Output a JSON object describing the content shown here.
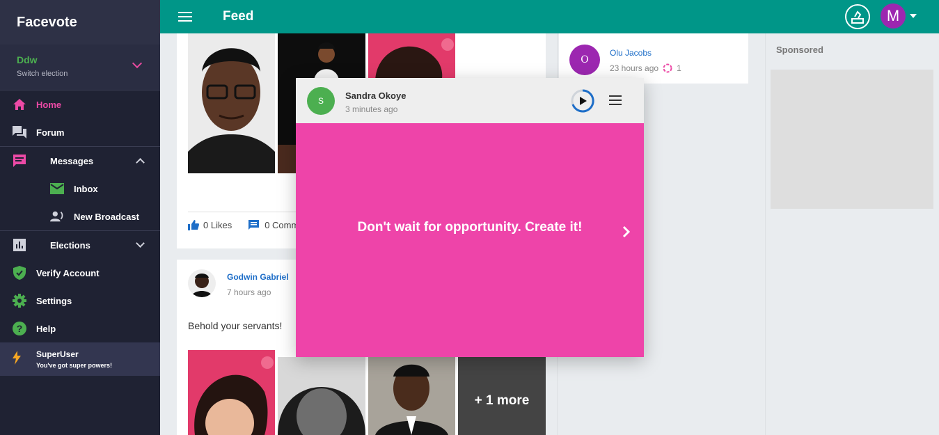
{
  "sidebar": {
    "brand": "Facevote",
    "election": {
      "name": "Ddw",
      "sub": "Switch election"
    },
    "items": [
      {
        "label": "Home",
        "icon": "home-icon"
      },
      {
        "label": "Forum",
        "icon": "forum-icon"
      },
      {
        "label": "Messages",
        "icon": "message-icon"
      },
      {
        "label": "Inbox",
        "icon": "mail-icon"
      },
      {
        "label": "New Broadcast",
        "icon": "broadcast-icon"
      },
      {
        "label": "Elections",
        "icon": "chart-icon"
      },
      {
        "label": "Verify Account",
        "icon": "shield-icon"
      },
      {
        "label": "Settings",
        "icon": "gear-icon"
      },
      {
        "label": "Help",
        "icon": "help-icon"
      }
    ],
    "superuser": {
      "title": "SuperUser",
      "sub": "You've got super powers!"
    }
  },
  "topbar": {
    "title": "Feed",
    "avatar_letter": "M"
  },
  "feed": {
    "post1": {
      "likes": "0 Likes",
      "comments": "0 Comm"
    },
    "post2": {
      "author": "Godwin Gabriel",
      "time": "7 hours ago",
      "text": "Behold your servants!",
      "more": "+ 1 more"
    }
  },
  "right": {
    "olu": {
      "initial": "O",
      "name": "Olu Jacobs",
      "time": "23 hours ago",
      "count": "1"
    },
    "sponsored": "Sponsored"
  },
  "story": {
    "initial": "S",
    "name": "Sandra Okoye",
    "time": "3 minutes ago",
    "text": "Don't wait for opportunity. Create it!",
    "bg_color": "#ee44a9"
  },
  "colors": {
    "accent": "#009688",
    "pink": "#ec4aa6",
    "green": "#4caf50",
    "purple": "#9c27b0"
  }
}
